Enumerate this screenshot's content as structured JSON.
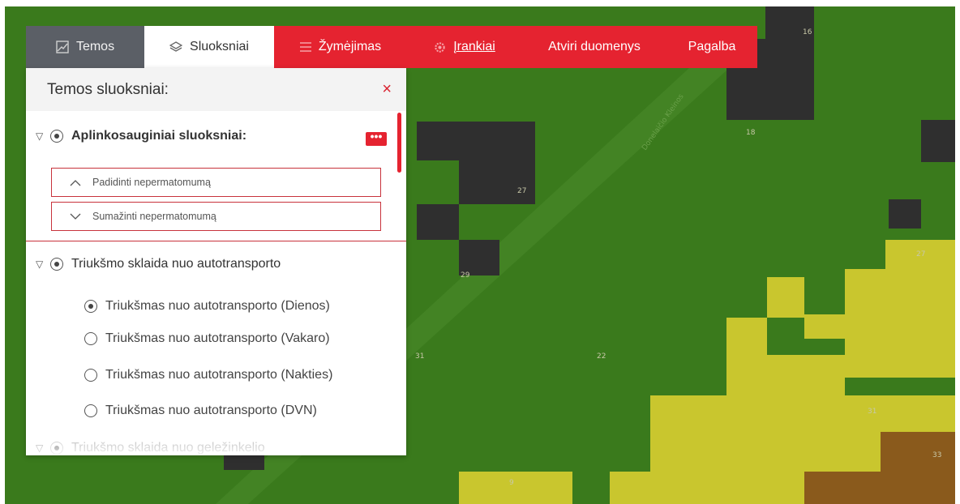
{
  "nav": {
    "tabs": [
      {
        "label": "Temos",
        "icon": "map-icon",
        "state": "inactive"
      },
      {
        "label": "Sluoksniai",
        "icon": "layers-icon",
        "state": "active"
      },
      {
        "label": "Žymėjimas",
        "icon": "list-icon",
        "state": "red"
      },
      {
        "label": "Įrankiai",
        "icon": "gear-icon",
        "state": "red"
      },
      {
        "label": "Atviri duomenys",
        "icon": "",
        "state": "red"
      },
      {
        "label": "Pagalba",
        "icon": "",
        "state": "red"
      }
    ]
  },
  "panel": {
    "title": "Temos sluoksniai:",
    "close_icon": "×",
    "group1": {
      "label": "Aplinkosauginiai sluoksniai:",
      "menu_icon": "•••"
    },
    "opacity": {
      "increase": "Padidinti nepermatomumą",
      "decrease": "Sumažinti nepermatomumą"
    },
    "group2": {
      "label": "Triukšmo sklaida nuo autotransporto",
      "items": [
        {
          "label": "Triukšmas nuo autotransporto (Dienos)",
          "selected": true
        },
        {
          "label": "Triukšmas nuo autotransporto (Vakaro)",
          "selected": false
        },
        {
          "label": "Triukšmas nuo autotransporto (Nakties)",
          "selected": false
        },
        {
          "label": "Triukšmas nuo autotransporto (DVN)",
          "selected": false
        }
      ]
    },
    "group3": {
      "label": "Triukšmo sklaida nuo geležinkelio"
    }
  },
  "map": {
    "street_label": "Donelaičio Kleinos",
    "labels": [
      "16",
      "18",
      "27",
      "29",
      "22",
      "31",
      "27",
      "31",
      "33",
      "9"
    ]
  },
  "colors": {
    "accent_red": "#e52330",
    "map_green": "#3a7a1c",
    "noise_yellow": "#c9c62e",
    "noise_brown": "#8a5a1c",
    "building_dark": "#2f2f2f"
  }
}
